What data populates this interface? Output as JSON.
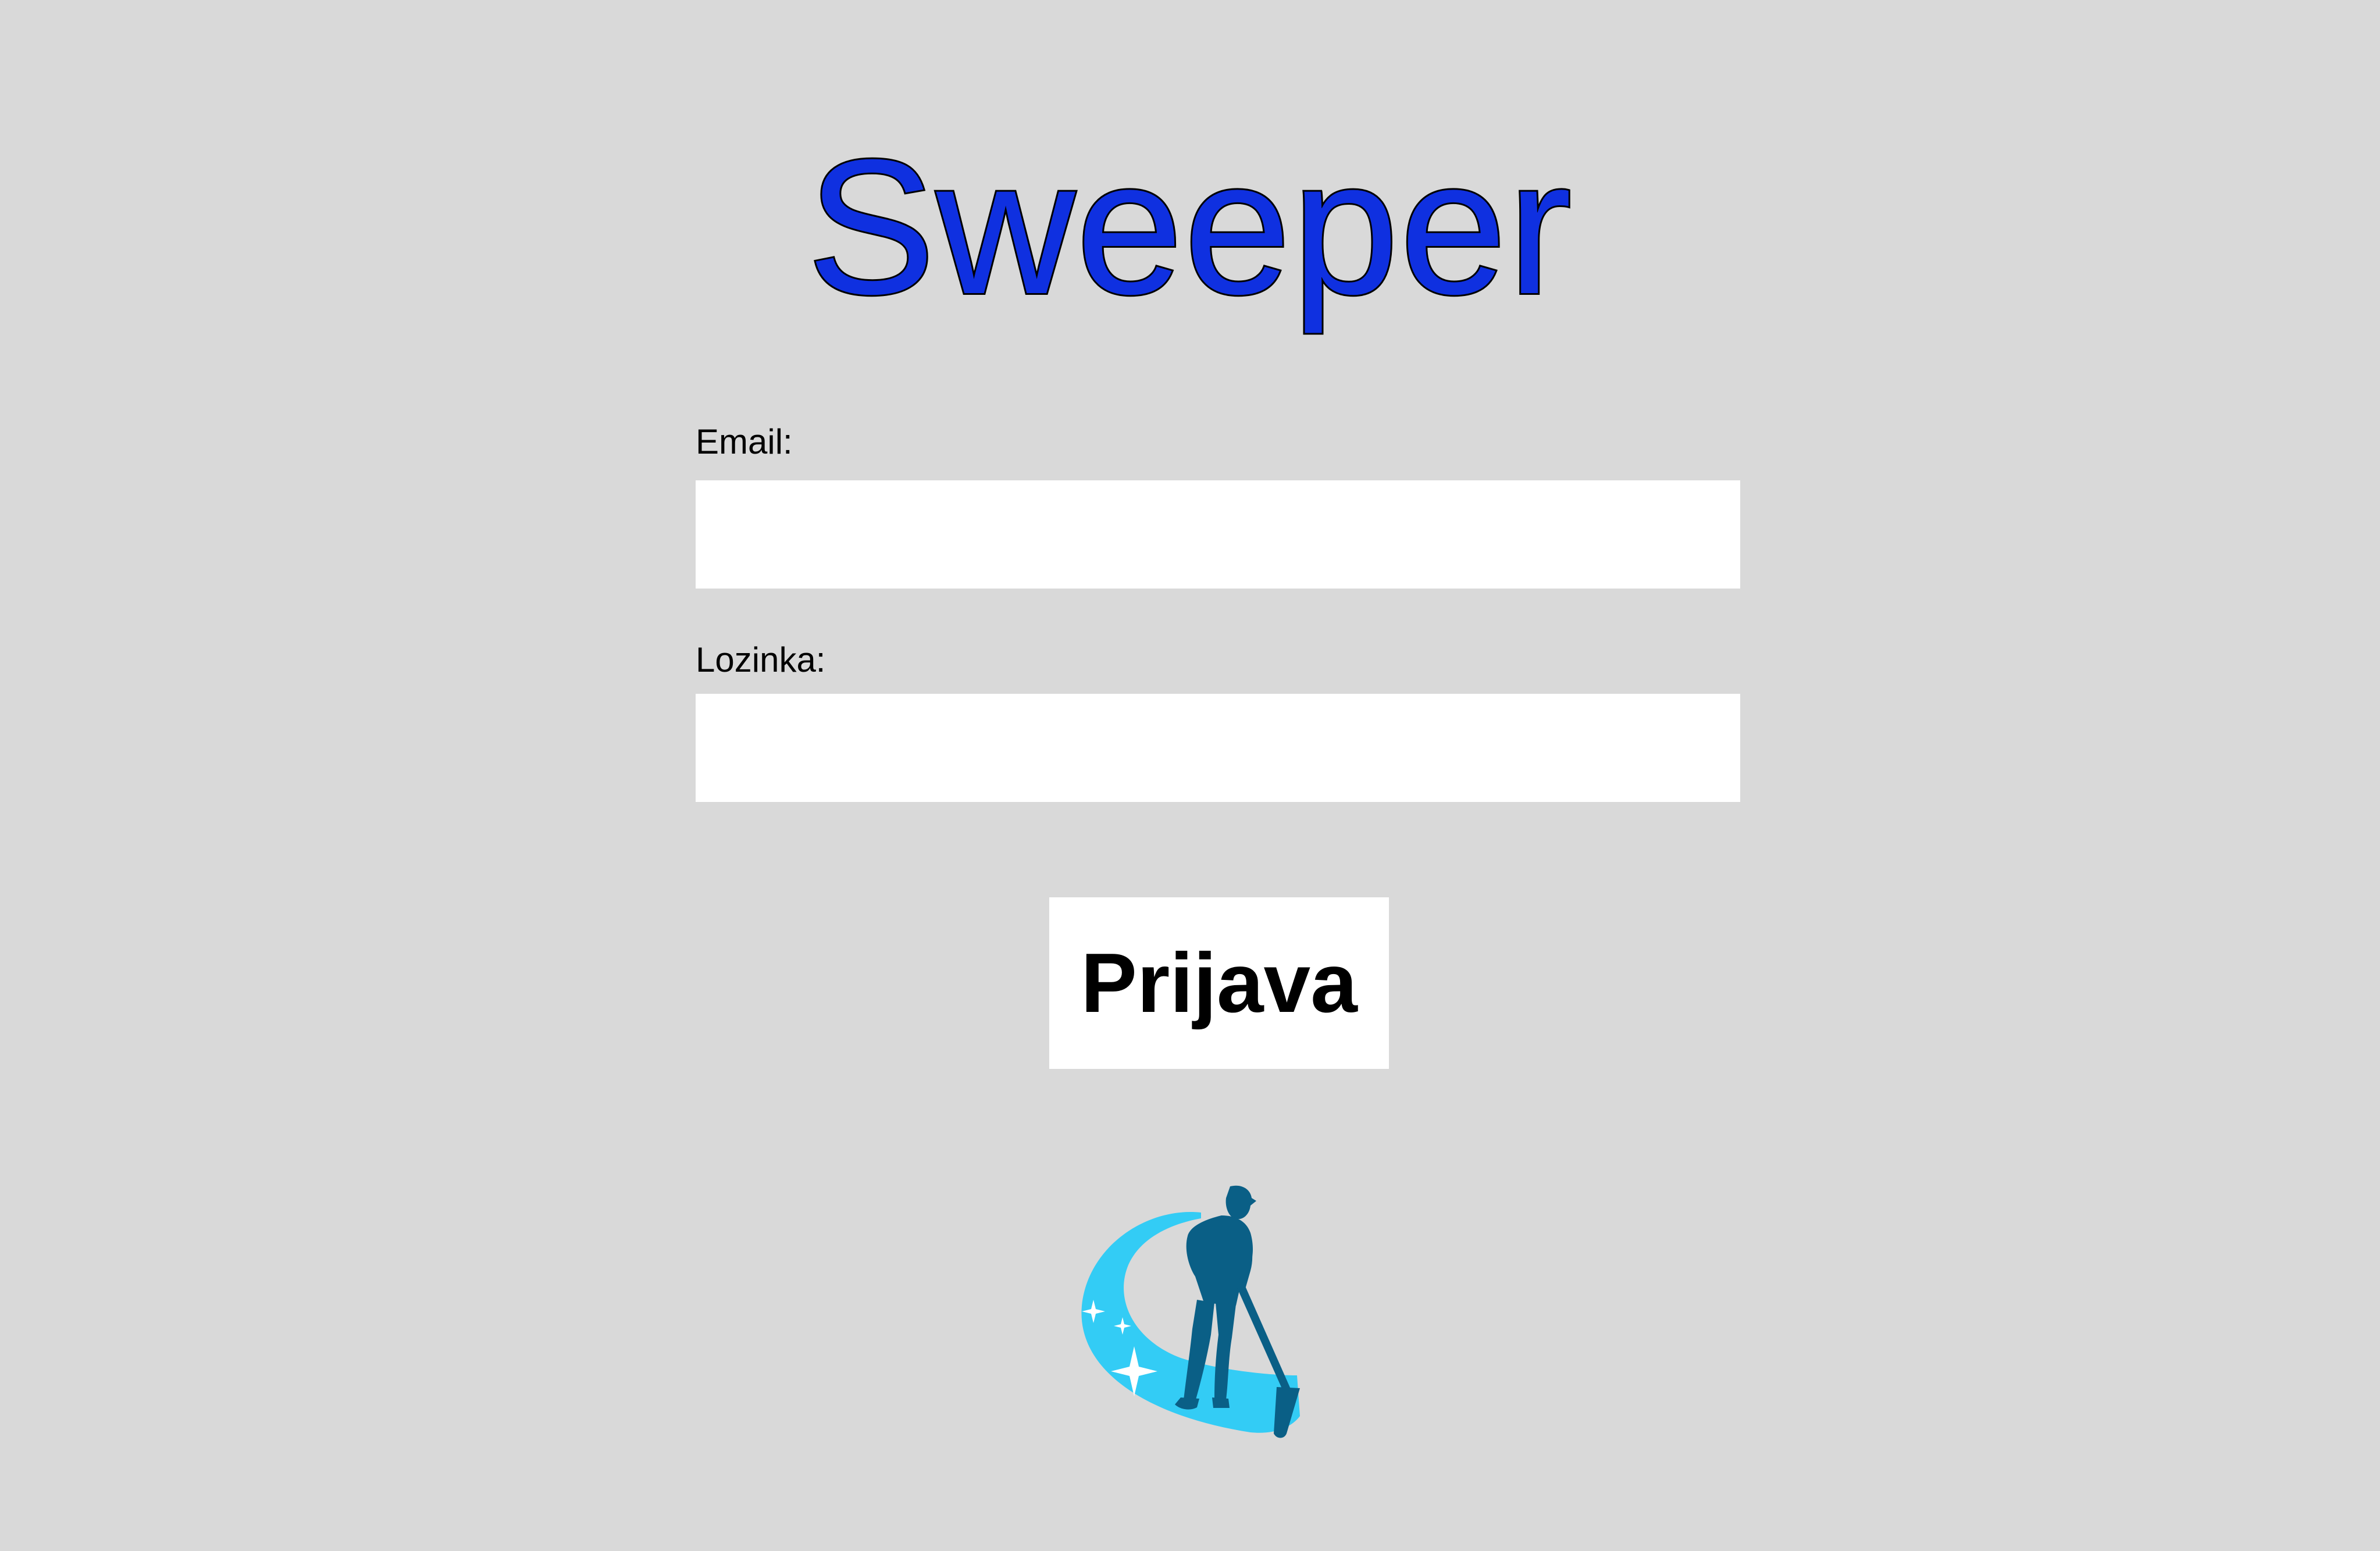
{
  "app": {
    "title": "Sweeper"
  },
  "form": {
    "email_label": "Email:",
    "email_value": "",
    "password_label": "Lozinka:",
    "password_value": "",
    "submit_label": "Prijava"
  },
  "logo": {
    "icon": "cleaner-with-mop-icon"
  },
  "colors": {
    "background": "#d9d9d9",
    "title": "#0f30e0",
    "logo_dark": "#0a5f86",
    "logo_light": "#33ccf5"
  }
}
